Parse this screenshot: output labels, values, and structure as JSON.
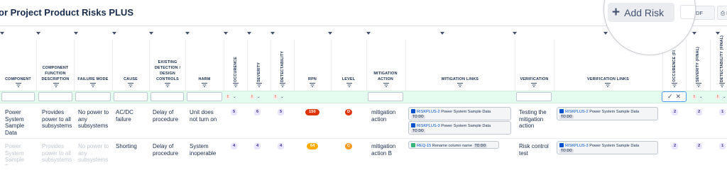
{
  "title": "or Project Product Risks PLUS",
  "toolbar": {
    "add_risk": "Add Risk",
    "export_pdf": "rt to PDF",
    "export_other": "E"
  },
  "columns": {
    "component": "COMPONENT",
    "function": "COMPONENT FUNCTION DESCRIPTION",
    "failure_mode": "FAILURE MODE",
    "cause": "CAUSE",
    "detection": "EXISTING DETECTION / DESIGN CONTROLS",
    "harm": "HARM",
    "occurence": "OCCURENCE",
    "severity": "SEVERITY",
    "detectability": "DETECTABILITY",
    "rpn": "RPN",
    "level": "LEVEL",
    "mitigation": "MITIGATION ACTION",
    "mitigation_links": "MITIGATION LINKS",
    "verification": "VERIFICATION",
    "verification_links": "VERIFICATION LINKS",
    "occurence_final": "OCCURENCE (FI",
    "severity_final": "SEVERITY (FINAL)",
    "detectability_final": "DETECTABILITY (FINAL)"
  },
  "filters": {
    "occ": "!",
    "sev": "!",
    "det": "!",
    "sev_f": "!",
    "det_f": "!",
    "check": "✓",
    "clear": "✕"
  },
  "rows": [
    {
      "component": "Power System Sample Data",
      "function": "Provides power to all subsystems",
      "failure_mode": "No power to any subsystems",
      "cause": "AC/DC failure",
      "detection": "Delay of procedure",
      "harm": "Unit does not turn on",
      "occurence": "5",
      "severity": "6",
      "detectability": "5",
      "rpn": "150",
      "level": "D",
      "mitigation": "mitigation action",
      "mitigation_links": [
        {
          "key": "RISKPLUS-2",
          "summary": "Power System Sample Data",
          "status": "TO DO"
        },
        {
          "key": "RISKPLUS-3",
          "summary": "Power System Sample Data",
          "status": "TO DO"
        }
      ],
      "verification": "Testing the mitigation action",
      "verification_links": [
        {
          "key": "RISKPLUS-2",
          "summary": "Power System Sample Data",
          "status": "TO DO"
        }
      ],
      "occ_final": "2",
      "sev_final": "2",
      "det_final": "1"
    },
    {
      "component": "Power System Sample Data",
      "function": "Provides power to all subsystems",
      "failure_mode": "No power to any subsystems",
      "cause": "Shorting",
      "detection": "Delay of procedure",
      "harm": "System inoperable",
      "occurence": "4",
      "severity": "4",
      "detectability": "4",
      "rpn": "64",
      "level": "C",
      "mitigation": "mitigation action B",
      "mitigation_links": [
        {
          "key": "REQ-15",
          "summary": "Rename column name",
          "status": "TO DO"
        }
      ],
      "verification": "Risk control test",
      "verification_links": [
        {
          "key": "RISKPLUS-3",
          "summary": "Power System Sample Data",
          "status": "TO DO"
        }
      ],
      "occ_final": "2",
      "sev_final": "2",
      "det_final": "1"
    }
  ],
  "colors": {
    "accent": "#0052cc",
    "filter_row": "#e3fcef",
    "rpn_high": "#de350b",
    "rpn_mid": "#ffab00",
    "level_d": "#de350b",
    "level_c": "#ff991f",
    "score_badge": "#eae6ff"
  }
}
